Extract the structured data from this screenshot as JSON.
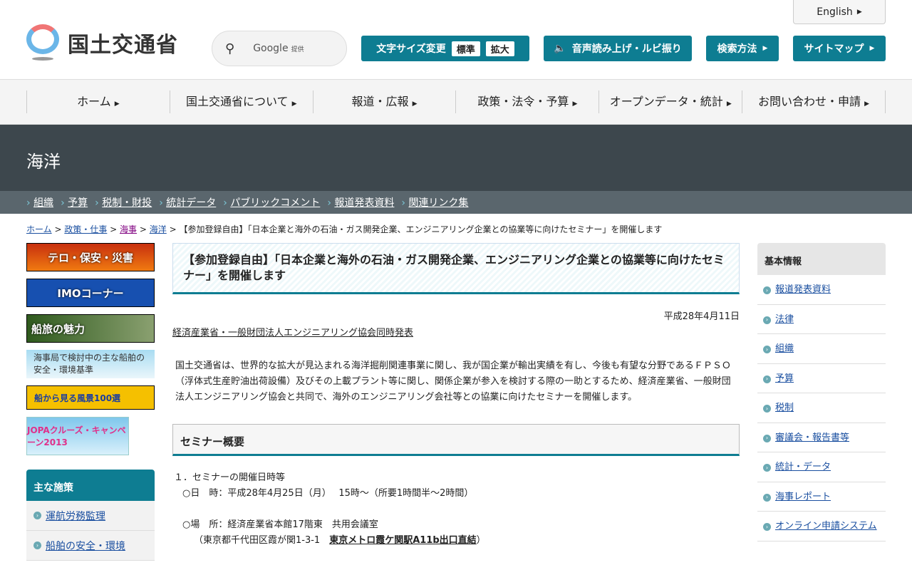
{
  "header": {
    "english": "English",
    "logo_text": "国土交通省",
    "search_brand": "Google",
    "search_provided": "提供",
    "font_size_label": "文字サイズ変更",
    "font_standard": "標準",
    "font_large": "拡大",
    "speech": "音声読み上げ・ルビ振り",
    "search_method": "検索方法",
    "sitemap": "サイトマップ"
  },
  "gnav": [
    "ホーム",
    "国土交通省について",
    "報道・広報",
    "政策・法令・予算",
    "オープンデータ・統計",
    "お問い合わせ・申請"
  ],
  "hero": "海洋",
  "subnav": [
    "組織",
    "予算",
    "税制・財投",
    "統計データ",
    "パブリックコメント",
    "報道発表資料",
    "関連リンク集"
  ],
  "breadcrumb": {
    "items": [
      "ホーム",
      "政策・仕事",
      "海事",
      "海洋"
    ],
    "current": "【参加登録自由】「日本企業と海外の石油・ガス開発企業、エンジニアリング企業との協業等に向けたセミナー」を開催します"
  },
  "left": {
    "banners": [
      "テロ・保安・災害",
      "IMOコーナー",
      "船旅の魅力",
      "海事局で検討中の主な船舶の安全・環境基準",
      "船から見る風景100選",
      "JOPAクルーズ・キャンペーン2013"
    ],
    "menu_title": "主な施策",
    "menu": [
      "運航労務監理",
      "船舶の安全・環境"
    ]
  },
  "main": {
    "title": "【参加登録自由】「日本企業と海外の石油・ガス開発企業、エンジニアリング企業との協業等に向けたセミナー」を開催します",
    "date": "平成28年4月11日",
    "joint": "経済産業省・一般財団法人エンジニアリング協会同時発表",
    "body": "国土交通省は、世界的な拡大が見込まれる海洋掘削関連事業に関し、我が国企業が輸出実績を有し、今後も有望な分野であるＦＰＳＯ（浮体式生産貯油出荷設備）及びその上載プラント等に関し、関係企業が参入を検討する際の一助とするため、経済産業省、一般財団法人エンジニアリング協会と共同で、海外のエンジニアリング会社等との協業に向けたセミナーを開催します。",
    "section": "セミナー概要",
    "item1": "１．セミナーの開催日時等",
    "datetime": "○日　時：平成28年4月25日（月）　 15時～（所要1時間半～2時間）",
    "place": "○場　所：経済産業省本館17階東　共用会議室",
    "addr_pre": "（東京都千代田区霞が関1-3-1　",
    "addr_link": "東京メトロ霞ケ関駅A11b出口直結",
    "addr_post": "）"
  },
  "right": {
    "title": "基本情報",
    "items": [
      "報道発表資料",
      "法律",
      "組織",
      "予算",
      "税制",
      "審議会・報告書等",
      "統計・データ",
      "海事レポート",
      "オンライン申請システム"
    ]
  }
}
